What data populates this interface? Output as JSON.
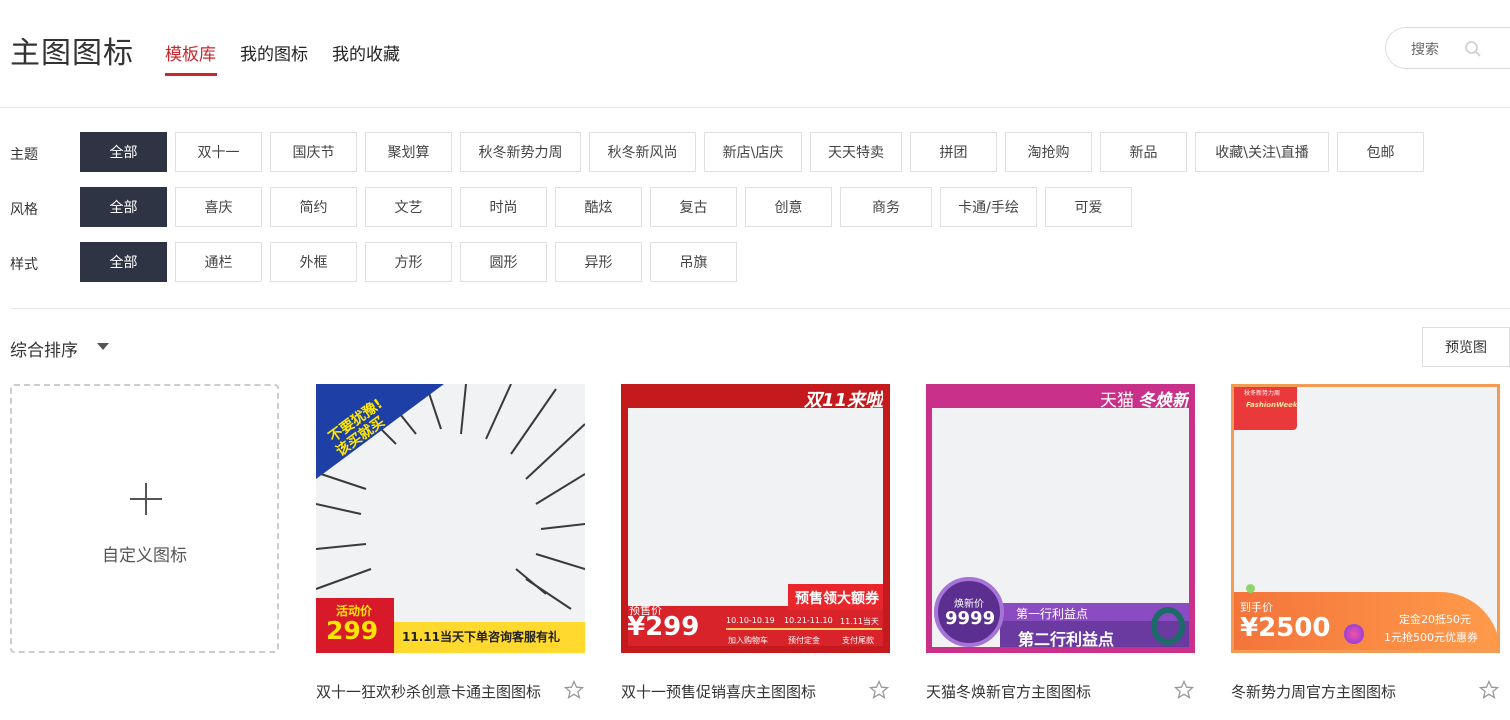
{
  "header": {
    "title": "主图图标",
    "tabs": [
      {
        "label": "模板库",
        "active": true
      },
      {
        "label": "我的图标",
        "active": false
      },
      {
        "label": "我的收藏",
        "active": false
      }
    ],
    "search_label": "搜索"
  },
  "filters": {
    "theme": {
      "label": "主题",
      "options": [
        "全部",
        "双十一",
        "国庆节",
        "聚划算",
        "秋冬新势力周",
        "秋冬新风尚",
        "新店\\店庆",
        "天天特卖",
        "拼团",
        "淘抢购",
        "新品",
        "收藏\\关注\\直播",
        "包邮"
      ]
    },
    "style": {
      "label": "风格",
      "options": [
        "全部",
        "喜庆",
        "简约",
        "文艺",
        "时尚",
        "酷炫",
        "复古",
        "创意",
        "商务",
        "卡通/手绘",
        "可爱"
      ]
    },
    "shape": {
      "label": "样式",
      "options": [
        "全部",
        "通栏",
        "外框",
        "方形",
        "圆形",
        "异形",
        "吊旗"
      ]
    }
  },
  "sort": {
    "label": "综合排序"
  },
  "preview_button": "预览图",
  "custom_card": {
    "label": "自定义图标"
  },
  "templates": [
    {
      "title": "双十一狂欢秒杀创意卡通主图图标",
      "badge_line1": "不要犹豫!",
      "badge_line2": "该买就买",
      "price_label": "活动价",
      "price": "299",
      "slogan": "11.11当天下单咨询客服有礼"
    },
    {
      "title": "双十一预售促销喜庆主图图标",
      "corner": "双11来啦",
      "coupon": "预售领大额券",
      "price_label": "预售价",
      "price": "¥299",
      "steps": [
        "10.10-10.19",
        "10.21-11.10",
        "11.11当天"
      ],
      "step_labels": [
        "加入购物车",
        "预付定金",
        "支付尾款"
      ]
    },
    {
      "title": "天猫冬焕新官方主图图标",
      "corner_a": "天猫",
      "corner_b": "冬焕新",
      "price_label": "焕新价",
      "price": "9999",
      "point1": "第一行利益点",
      "point2": "第二行利益点"
    },
    {
      "title": "冬新势力周官方主图图标",
      "corner_a": "秋冬新势力周",
      "corner_b": "FashionWeek",
      "price_label": "到手价",
      "price": "¥2500",
      "promo1": "定金20抵50元",
      "promo2": "1元抢500元优惠券"
    }
  ],
  "colors": {
    "accent": "#c8282d",
    "chip_active_bg": "#2e3443"
  }
}
